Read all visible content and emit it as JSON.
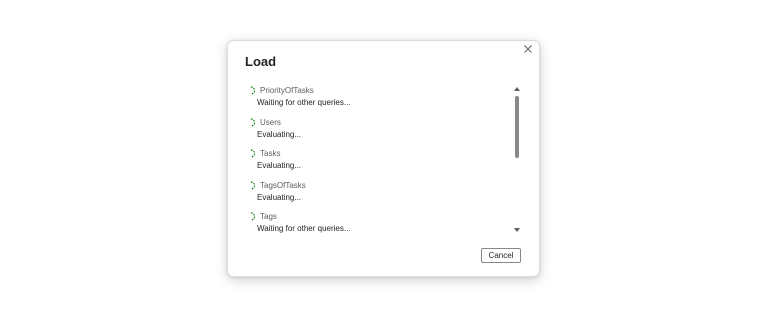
{
  "dialog": {
    "title": "Load",
    "close_icon": "close-icon",
    "cancel_label": "Cancel"
  },
  "queries": [
    {
      "name": "PriorityOfTasks",
      "status": "Waiting for other queries..."
    },
    {
      "name": "Users",
      "status": "Evaluating..."
    },
    {
      "name": "Tasks",
      "status": "Evaluating..."
    },
    {
      "name": "TagsOfTasks",
      "status": "Evaluating..."
    },
    {
      "name": "Tags",
      "status": "Waiting for other queries..."
    }
  ],
  "colors": {
    "spinner": "#107c10",
    "text": "#252423",
    "subtle_text": "#605e5c",
    "scrollbar_thumb": "#8a8886"
  }
}
